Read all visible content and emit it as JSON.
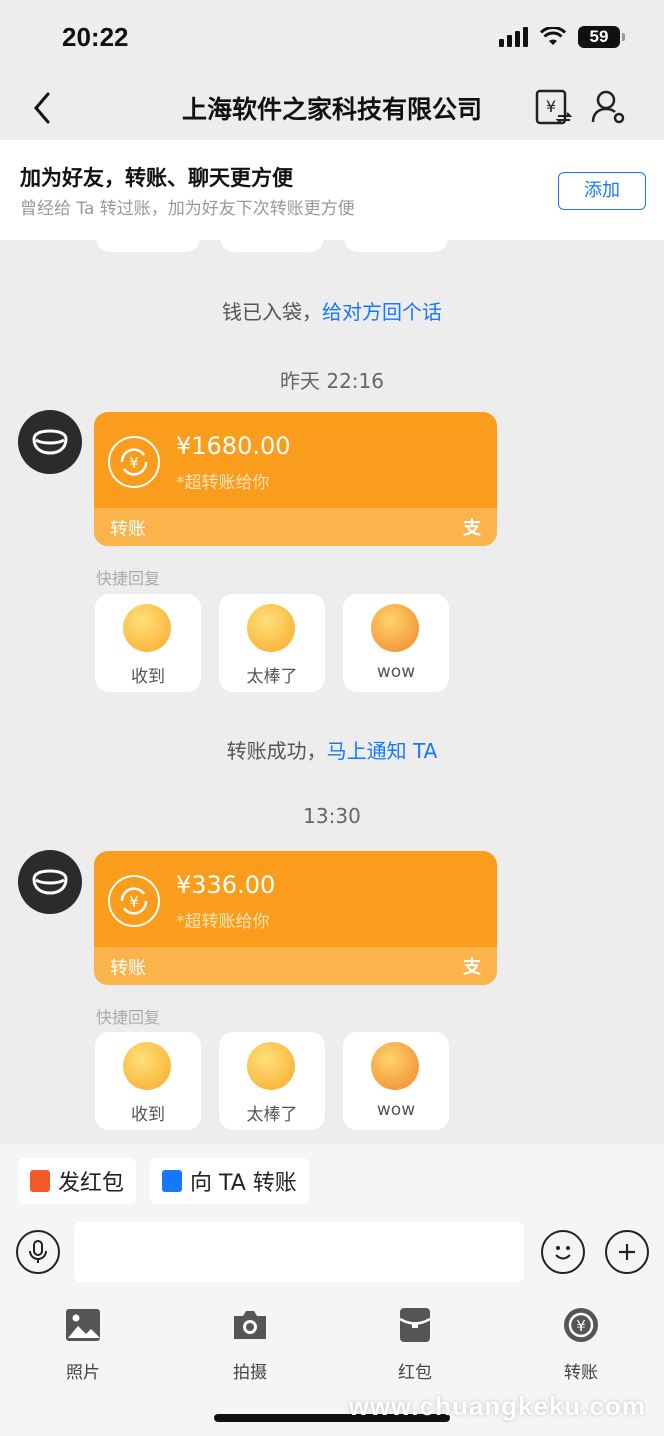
{
  "status_bar": {
    "time": "20:22",
    "battery": "59"
  },
  "nav": {
    "title": "上海软件之家科技有限公司"
  },
  "banner": {
    "title": "加为好友，转账、聊天更方便",
    "subtitle": "曾经给 Ta 转过账，加为好友下次转账更方便",
    "add_label": "添加"
  },
  "messages": {
    "received_notice": {
      "text": "钱已入袋，",
      "link": "给对方回个话"
    },
    "time1": "昨天 22:16",
    "transfer1": {
      "amount": "¥1680.00",
      "note": "*超转账给你",
      "label": "转账",
      "provider": "支"
    },
    "quick_label1": "快捷回复",
    "quick1": [
      {
        "label": "收到"
      },
      {
        "label": "太棒了"
      },
      {
        "label": "wow"
      }
    ],
    "success_notice": {
      "text": "转账成功，",
      "link": "马上通知 TA"
    },
    "time2": "13:30",
    "transfer2": {
      "amount": "¥336.00",
      "note": "*超转账给你",
      "label": "转账",
      "provider": "支"
    },
    "quick_label2": "快捷回复",
    "quick2": [
      {
        "label": "收到"
      },
      {
        "label": "太棒了"
      },
      {
        "label": "wow"
      }
    ]
  },
  "actions": {
    "red_packet": "发红包",
    "transfer_to": "向 TA 转账"
  },
  "input": {
    "placeholder": ""
  },
  "tools": [
    {
      "label": "照片"
    },
    {
      "label": "拍摄"
    },
    {
      "label": "红包"
    },
    {
      "label": "转账"
    }
  ],
  "watermark": "www.chuangkeku.com",
  "colors": {
    "accent": "#1677ff",
    "transfer_card": "#fa9d1c",
    "red_packet": "#f25a2a"
  }
}
